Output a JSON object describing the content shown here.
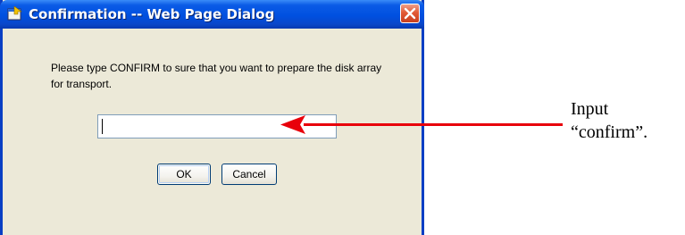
{
  "dialog": {
    "title": "Confirmation -- Web Page Dialog",
    "message": "Please type CONFIRM to sure that you want to prepare the disk array for transport.",
    "input_value": "",
    "ok_label": "OK",
    "cancel_label": "Cancel",
    "icons": {
      "title": "dialog-app-icon",
      "close": "close-icon"
    }
  },
  "annotation": {
    "line1": "Input",
    "line2": "“confirm”.",
    "arrow_color": "#E8000B"
  },
  "colors": {
    "titlebar": "#0050E0",
    "dialog_bg": "#ECE9D8",
    "close_button": "#E15A36"
  }
}
